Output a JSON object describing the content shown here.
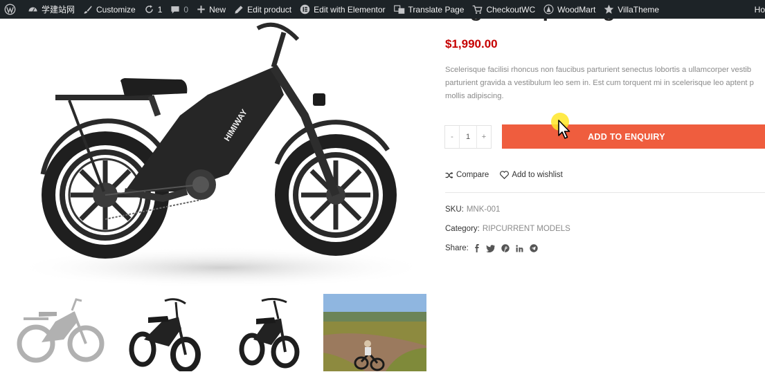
{
  "adminbar": {
    "site_name": "学建站网",
    "customize": "Customize",
    "updates_count": "1",
    "comments_count": "0",
    "new": "New",
    "edit_product": "Edit product",
    "edit_elementor": "Edit with Elementor",
    "translate": "Translate Page",
    "checkoutwc": "CheckoutWC",
    "woodmart": "WoodMart",
    "villatheme": "VillaTheme",
    "right_cut": "Ho"
  },
  "product": {
    "title_peek": "Fugiat adipiscing euismod",
    "price": "$1,990.00",
    "description_lines": [
      "Scelerisque facilisi rhoncus non faucibus parturient senectus lobortis a ullamcorper vestib",
      "parturient gravida a vestibulum leo sem in. Est cum torquent mi in scelerisque leo aptent p",
      "mollis adipiscing."
    ],
    "quantity": {
      "minus": "-",
      "value": "1",
      "plus": "+"
    },
    "enquiry_button": "ADD TO ENQUIRY",
    "compare": "Compare",
    "wishlist": "Add to wishlist",
    "sku_label": "SKU:",
    "sku_value": "MNK-001",
    "category_label": "Category:",
    "category_value": "RIPCURRENT MODELS",
    "share_label": "Share:",
    "share_icons": [
      "facebook-icon",
      "twitter-icon",
      "pinterest-icon",
      "linkedin-icon",
      "telegram-icon"
    ],
    "bike_brand": "HIMIWAY"
  },
  "colors": {
    "adminbar_bg": "#1d2327",
    "price": "#c60000",
    "enquiry_button": "#ef5d3e",
    "muted_text": "#8a8a8a"
  }
}
